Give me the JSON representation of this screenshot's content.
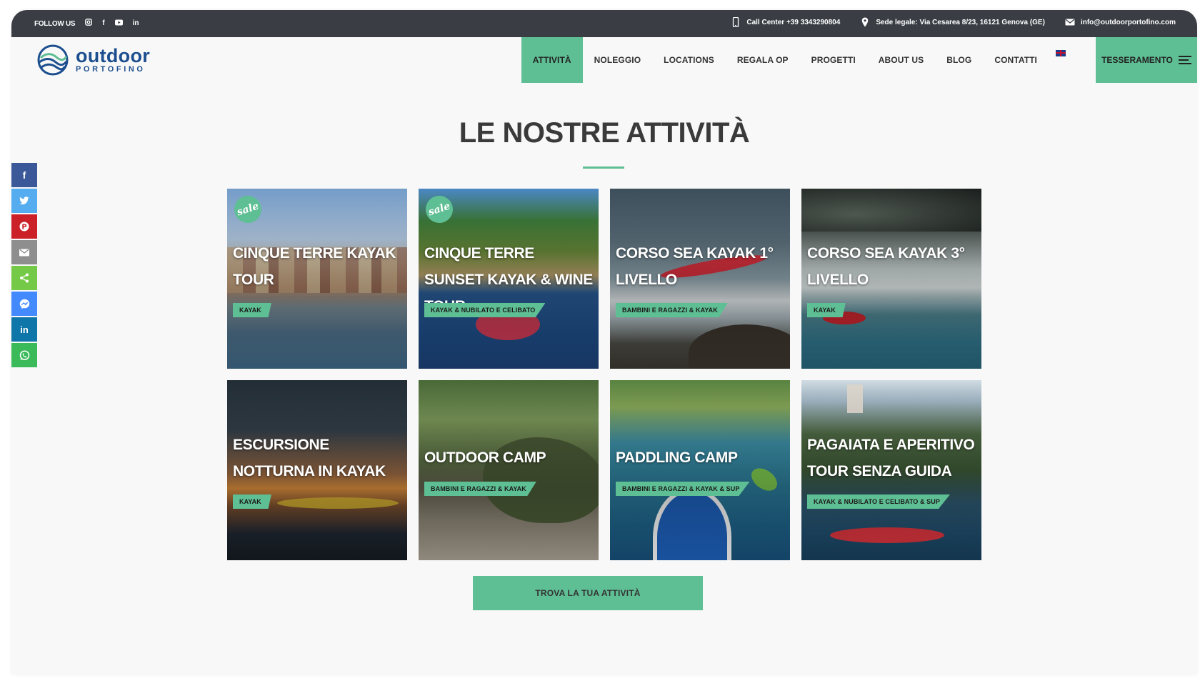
{
  "topbar": {
    "follow_label": "FOLLOW US",
    "social_icons": [
      "instagram-icon",
      "facebook-icon",
      "youtube-icon",
      "linkedin-icon"
    ],
    "call_center": "Call Center +39 3343290804",
    "address": "Sede legale: Via Cesarea 8/23, 16121 Genova (GE)",
    "email": "info@outdoorportofino.com"
  },
  "logo": {
    "line1": "outdoor",
    "line2": "PORTOFINO"
  },
  "nav": {
    "items": [
      "ATTIVITÀ",
      "NOLEGGIO",
      "LOCATIONS",
      "REGALA OP",
      "PROGETTI",
      "ABOUT US",
      "BLOG",
      "CONTATTI"
    ],
    "active_index": 0,
    "language_flag": "uk-flag-icon",
    "cta": "TESSERAMENTO"
  },
  "share": {
    "buttons": [
      {
        "name": "facebook",
        "glyph": "f",
        "color": "#3b5998"
      },
      {
        "name": "twitter",
        "glyph": "t",
        "color": "#55acee"
      },
      {
        "name": "pinterest",
        "glyph": "P",
        "color": "#cb2027"
      },
      {
        "name": "email",
        "glyph": "✉",
        "color": "#8e8e8e"
      },
      {
        "name": "share",
        "glyph": "<",
        "color": "#74c947"
      },
      {
        "name": "messenger",
        "glyph": "m",
        "color": "#448aff"
      },
      {
        "name": "linkedin",
        "glyph": "in",
        "color": "#0e76a8"
      },
      {
        "name": "whatsapp",
        "glyph": "w",
        "color": "#3bba5a"
      }
    ]
  },
  "section": {
    "title": "LE NOSTRE ATTIVITÀ"
  },
  "cards": [
    {
      "title": "CINQUE TERRE KAYAK TOUR",
      "tag": "KAYAK",
      "sale": true,
      "sale_label": "sale"
    },
    {
      "title": "CINQUE TERRE SUNSET KAYAK & WINE TOUR",
      "tag": "KAYAK & NUBILATO E CELIBATO",
      "sale": true,
      "sale_label": "sale"
    },
    {
      "title": "CORSO SEA KAYAK 1° LIVELLO",
      "tag": "BAMBINI E RAGAZZI & KAYAK",
      "sale": false
    },
    {
      "title": "CORSO SEA KAYAK 3° LIVELLO",
      "tag": "KAYAK",
      "sale": false
    },
    {
      "title": "ESCURSIONE NOTTURNA IN KAYAK",
      "tag": "KAYAK",
      "sale": false
    },
    {
      "title": "OUTDOOR CAMP",
      "tag": "BAMBINI E RAGAZZI & KAYAK",
      "sale": false
    },
    {
      "title": "PADDLING CAMP",
      "tag": "BAMBINI E RAGAZZI & KAYAK & SUP",
      "sale": false
    },
    {
      "title": "PAGAIATA E APERITIVO TOUR SENZA GUIDA",
      "tag": "KAYAK & NUBILATO E CELIBATO & SUP",
      "sale": false
    }
  ],
  "cta_button": "TROVA LA TUA ATTIVITÀ",
  "colors": {
    "accent": "#5fbf94",
    "topbar": "#3a3e44",
    "brand": "#1d4f8f"
  }
}
